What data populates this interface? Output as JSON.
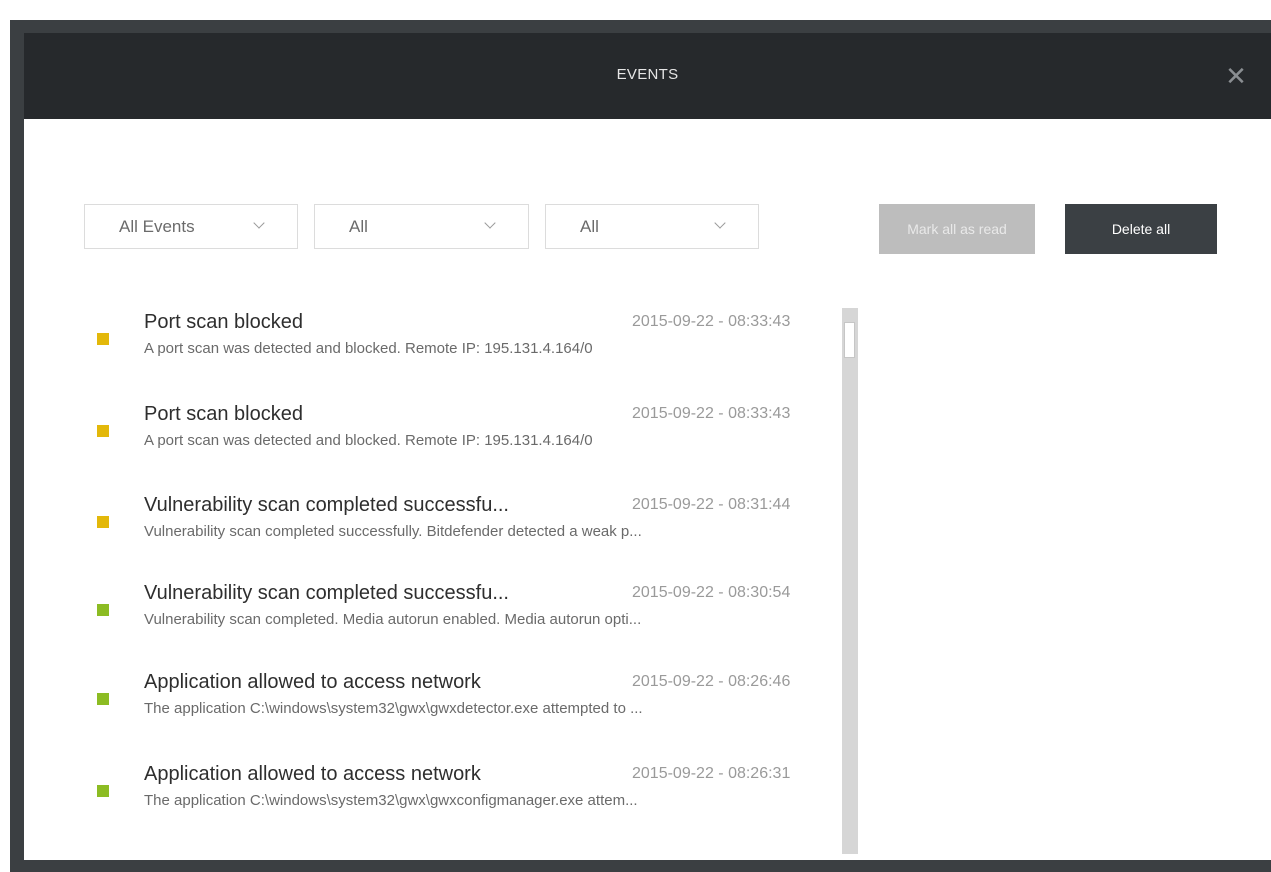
{
  "window": {
    "title": "EVENTS",
    "close_icon": "close-icon",
    "close_glyph": "✕"
  },
  "filters": [
    {
      "selected": "All Events"
    },
    {
      "selected": "All"
    },
    {
      "selected": "All"
    }
  ],
  "actions": {
    "mark_all_read": "Mark all as read",
    "delete_all": "Delete all"
  },
  "colors": {
    "warning": "#e3b80a",
    "info": "#8cbc23"
  },
  "events": [
    {
      "title": "Port scan blocked",
      "time": "2015-09-22 - 08:33:43",
      "desc": "A port scan was detected and blocked. Remote IP: 195.131.4.164/0",
      "status": "warning"
    },
    {
      "title": "Port scan blocked",
      "time": "2015-09-22 - 08:33:43",
      "desc": "A port scan was detected and blocked. Remote IP: 195.131.4.164/0",
      "status": "warning"
    },
    {
      "title": "Vulnerability scan completed successfu...",
      "time": "2015-09-22 - 08:31:44",
      "desc": "Vulnerability scan completed successfully. Bitdefender detected a weak p...",
      "status": "warning"
    },
    {
      "title": "Vulnerability scan completed successfu...",
      "time": "2015-09-22 - 08:30:54",
      "desc": "Vulnerability scan completed. Media autorun enabled. Media autorun opti...",
      "status": "info"
    },
    {
      "title": "Application allowed to access network",
      "time": "2015-09-22 - 08:26:46",
      "desc": "The application C:\\windows\\system32\\gwx\\gwxdetector.exe attempted to ...",
      "status": "info"
    },
    {
      "title": "Application allowed to access network",
      "time": "2015-09-22 - 08:26:31",
      "desc": "The application C:\\windows\\system32\\gwx\\gwxconfigmanager.exe attem...",
      "status": "info"
    }
  ]
}
